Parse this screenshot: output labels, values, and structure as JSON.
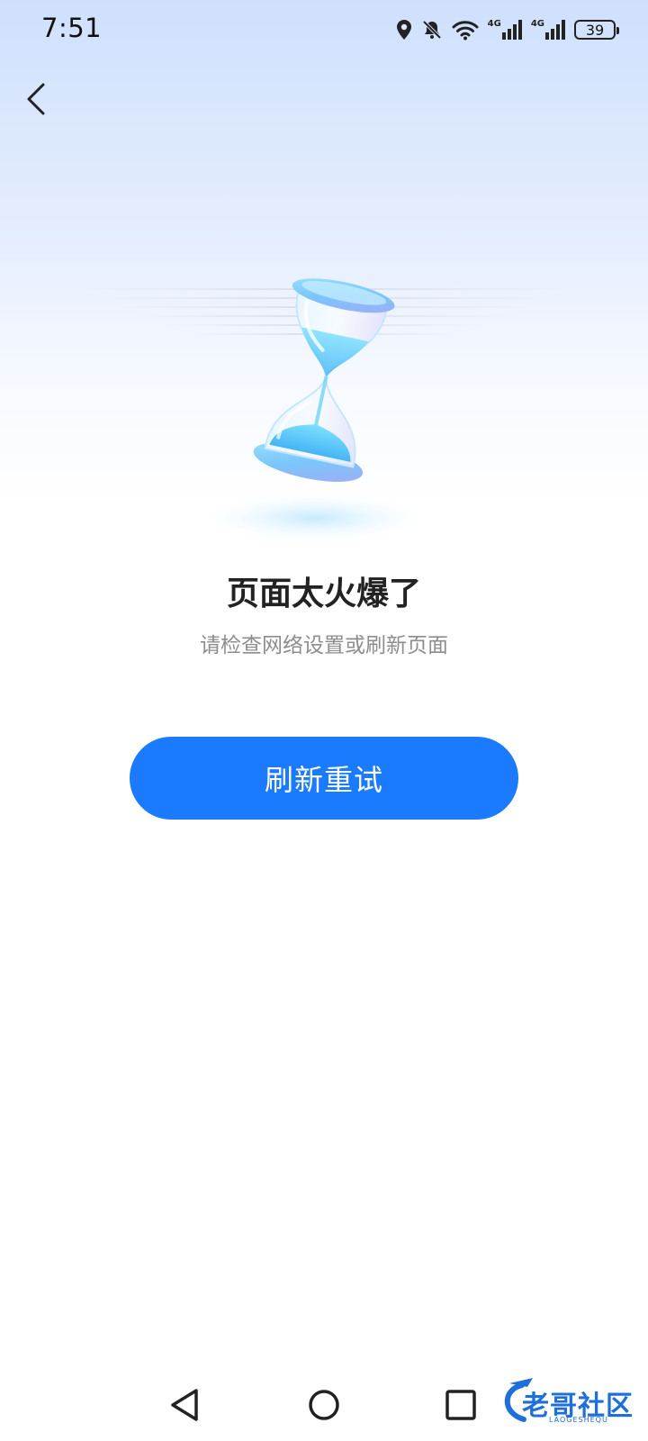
{
  "status_bar": {
    "time": "7:51",
    "network_1": "4G",
    "network_2": "4G",
    "battery_level": "39",
    "icons": [
      "location-icon",
      "bell-muted-icon",
      "wifi-icon",
      "signal-4g-icon",
      "signal-4g-icon",
      "battery-icon"
    ]
  },
  "header": {
    "back_icon": "chevron-left-icon"
  },
  "main": {
    "illustration": "hourglass-icon",
    "title": "页面太火爆了",
    "subtitle": "请检查网络设置或刷新页面",
    "retry_label": "刷新重试"
  },
  "nav_bar": {
    "icons": [
      "nav-back-icon",
      "nav-home-icon",
      "nav-recents-icon"
    ]
  },
  "watermark": {
    "text": "老哥社区",
    "subtext": "LAOGESHEQU"
  },
  "colors": {
    "accent": "#1a7bff",
    "title": "#222222",
    "subtitle": "#8d8d8d"
  }
}
